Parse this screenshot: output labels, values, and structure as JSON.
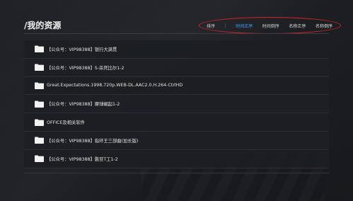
{
  "page": {
    "title": "/我的资源"
  },
  "sort": {
    "label": "排序",
    "separator": "|",
    "options": [
      {
        "label": "时间正序",
        "active": true
      },
      {
        "label": "时间倒序",
        "active": false
      },
      {
        "label": "名称正序",
        "active": false
      },
      {
        "label": "名称倒序",
        "active": false
      }
    ],
    "highlight_color": "#d8232a",
    "active_color": "#3fa3ff"
  },
  "files": [
    {
      "name": "【公众号：VIP98388】银行大满贯",
      "icon": "folder-icon"
    },
    {
      "name": "【公众号：VIP98388】S-杀死比尔1-2",
      "icon": "folder-icon"
    },
    {
      "name": "Great.Expectations.1998.720p.WEB-DL.AAC2.0.H.264-CtrlHD",
      "icon": "folder-icon"
    },
    {
      "name": "【公众号：VIP98388】摩球崛起1-2",
      "icon": "folder-icon"
    },
    {
      "name": "OFFICE及相关软件",
      "icon": "folder-icon"
    },
    {
      "name": "【公众号：VIP98388】指环王三部曲(加长版)",
      "icon": "folder-icon"
    },
    {
      "name": "【公众号：VIP98388】憨豆T工1-2",
      "icon": "folder-icon"
    }
  ]
}
